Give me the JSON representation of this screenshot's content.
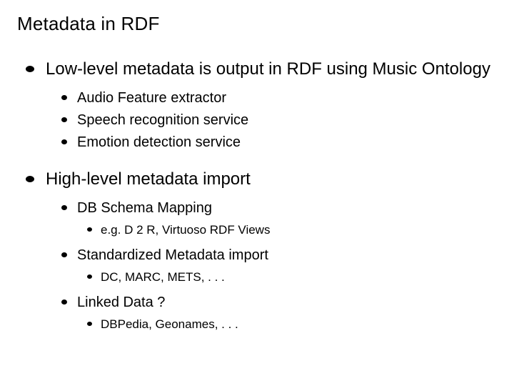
{
  "title": "Metadata in RDF",
  "items": [
    {
      "text": "Low-level metadata is output in RDF using Music Ontology",
      "children": [
        {
          "text": "Audio Feature extractor"
        },
        {
          "text": "Speech recognition service"
        },
        {
          "text": "Emotion detection service"
        }
      ]
    },
    {
      "text": "High-level metadata import",
      "children": [
        {
          "text": "DB Schema Mapping",
          "children": [
            {
              "text": "e.g. D 2 R, Virtuoso RDF Views"
            }
          ]
        },
        {
          "text": "Standardized Metadata import",
          "children": [
            {
              "text": "DC, MARC, METS, . . ."
            }
          ]
        },
        {
          "text": "Linked Data ?",
          "children": [
            {
              "text": "DBPedia, Geonames, . . ."
            }
          ]
        }
      ]
    }
  ]
}
